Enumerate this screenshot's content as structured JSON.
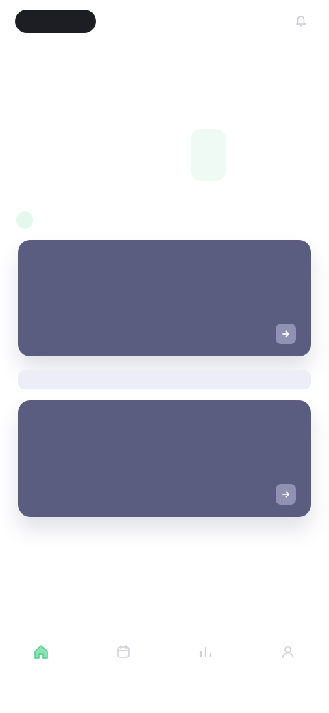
{
  "topbar": {
    "pill_label": "",
    "right_label": "",
    "right_icon": "bell-icon"
  },
  "header": {
    "greeting": "",
    "subtitle": ""
  },
  "week": {
    "days": [
      {
        "name": "",
        "num": ""
      },
      {
        "name": "",
        "num": ""
      },
      {
        "name": "",
        "num": ""
      },
      {
        "name": "",
        "num": ""
      },
      {
        "name": "",
        "num": ""
      },
      {
        "name": "",
        "num": ""
      },
      {
        "name": "",
        "num": ""
      }
    ],
    "active_index": 4
  },
  "section": {
    "label": ""
  },
  "cards": [
    {
      "title": "",
      "meta": "",
      "icon": "arrow-right-icon"
    },
    {
      "title": "",
      "meta": "",
      "icon": "arrow-right-icon"
    }
  ],
  "view_all": "",
  "nav": {
    "items": [
      {
        "label": "",
        "icon": "home-icon"
      },
      {
        "label": "",
        "icon": "calendar-icon"
      },
      {
        "label": "",
        "icon": "chart-icon"
      },
      {
        "label": "",
        "icon": "profile-icon"
      }
    ],
    "active_index": 0
  },
  "colors": {
    "accent": "#4fcf8c",
    "card": "#5a5d80",
    "pill": "#1d1d24"
  }
}
